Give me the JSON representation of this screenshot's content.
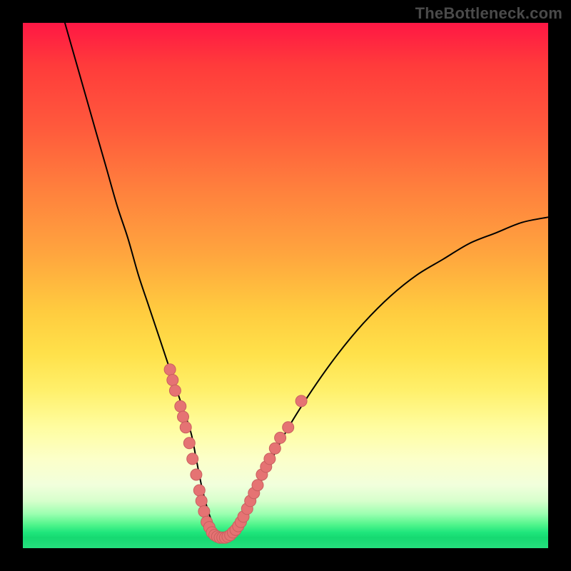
{
  "watermark": "TheBottleneck.com",
  "chart_data": {
    "type": "line",
    "title": "",
    "xlabel": "",
    "ylabel": "",
    "xlim": [
      0,
      100
    ],
    "ylim": [
      0,
      100
    ],
    "series": [
      {
        "name": "bottleneck-curve",
        "x": [
          8,
          10,
          12,
          14,
          16,
          18,
          20,
          22,
          24,
          26,
          28,
          30,
          32,
          33,
          34,
          35,
          36,
          37,
          38,
          39,
          40,
          42,
          44,
          46,
          50,
          55,
          60,
          65,
          70,
          75,
          80,
          85,
          90,
          95,
          100
        ],
        "values": [
          100,
          93,
          86,
          79,
          72,
          65,
          59,
          52,
          46,
          40,
          34,
          28,
          22,
          17,
          12,
          8,
          5,
          3,
          2,
          2,
          3,
          6,
          10,
          14,
          22,
          30,
          37,
          43,
          48,
          52,
          55,
          58,
          60,
          62,
          63
        ]
      }
    ],
    "markers": [
      {
        "series": "left-cluster",
        "x": 28.0,
        "y": 34
      },
      {
        "series": "left-cluster",
        "x": 28.5,
        "y": 32
      },
      {
        "series": "left-cluster",
        "x": 29.0,
        "y": 30
      },
      {
        "series": "left-cluster",
        "x": 30.0,
        "y": 27
      },
      {
        "series": "left-cluster",
        "x": 30.5,
        "y": 25
      },
      {
        "series": "left-cluster",
        "x": 31.0,
        "y": 23
      },
      {
        "series": "left-cluster",
        "x": 31.7,
        "y": 20
      },
      {
        "series": "left-cluster",
        "x": 32.3,
        "y": 17
      },
      {
        "series": "left-cluster",
        "x": 33.0,
        "y": 14
      },
      {
        "series": "left-cluster",
        "x": 33.6,
        "y": 11
      },
      {
        "series": "left-cluster",
        "x": 34.0,
        "y": 9
      },
      {
        "series": "left-cluster",
        "x": 34.5,
        "y": 7
      },
      {
        "series": "bottom-cluster",
        "x": 35.0,
        "y": 5
      },
      {
        "series": "bottom-cluster",
        "x": 35.5,
        "y": 4
      },
      {
        "series": "bottom-cluster",
        "x": 36.0,
        "y": 3
      },
      {
        "series": "bottom-cluster",
        "x": 36.5,
        "y": 2.5
      },
      {
        "series": "bottom-cluster",
        "x": 37.0,
        "y": 2.2
      },
      {
        "series": "bottom-cluster",
        "x": 37.5,
        "y": 2
      },
      {
        "series": "bottom-cluster",
        "x": 38.0,
        "y": 2
      },
      {
        "series": "bottom-cluster",
        "x": 38.5,
        "y": 2
      },
      {
        "series": "bottom-cluster",
        "x": 39.0,
        "y": 2.2
      },
      {
        "series": "bottom-cluster",
        "x": 39.5,
        "y": 2.5
      },
      {
        "series": "bottom-cluster",
        "x": 40.0,
        "y": 3
      },
      {
        "series": "bottom-cluster",
        "x": 40.5,
        "y": 3.5
      },
      {
        "series": "bottom-cluster",
        "x": 41.0,
        "y": 4.2
      },
      {
        "series": "right-cluster",
        "x": 41.5,
        "y": 5
      },
      {
        "series": "right-cluster",
        "x": 42.0,
        "y": 6
      },
      {
        "series": "right-cluster",
        "x": 42.7,
        "y": 7.5
      },
      {
        "series": "right-cluster",
        "x": 43.3,
        "y": 9
      },
      {
        "series": "right-cluster",
        "x": 44.0,
        "y": 10.5
      },
      {
        "series": "right-cluster",
        "x": 44.7,
        "y": 12
      },
      {
        "series": "right-cluster",
        "x": 45.5,
        "y": 14
      },
      {
        "series": "right-cluster",
        "x": 46.3,
        "y": 15.5
      },
      {
        "series": "right-cluster",
        "x": 47.0,
        "y": 17
      },
      {
        "series": "right-cluster",
        "x": 48.0,
        "y": 19
      },
      {
        "series": "right-cluster",
        "x": 49.0,
        "y": 21
      },
      {
        "series": "right-cluster",
        "x": 50.5,
        "y": 23
      },
      {
        "series": "right-outlier",
        "x": 53.0,
        "y": 28
      }
    ],
    "colors": {
      "curve": "#000000",
      "marker_fill": "#e57373",
      "marker_stroke": "#c95f5f"
    }
  }
}
